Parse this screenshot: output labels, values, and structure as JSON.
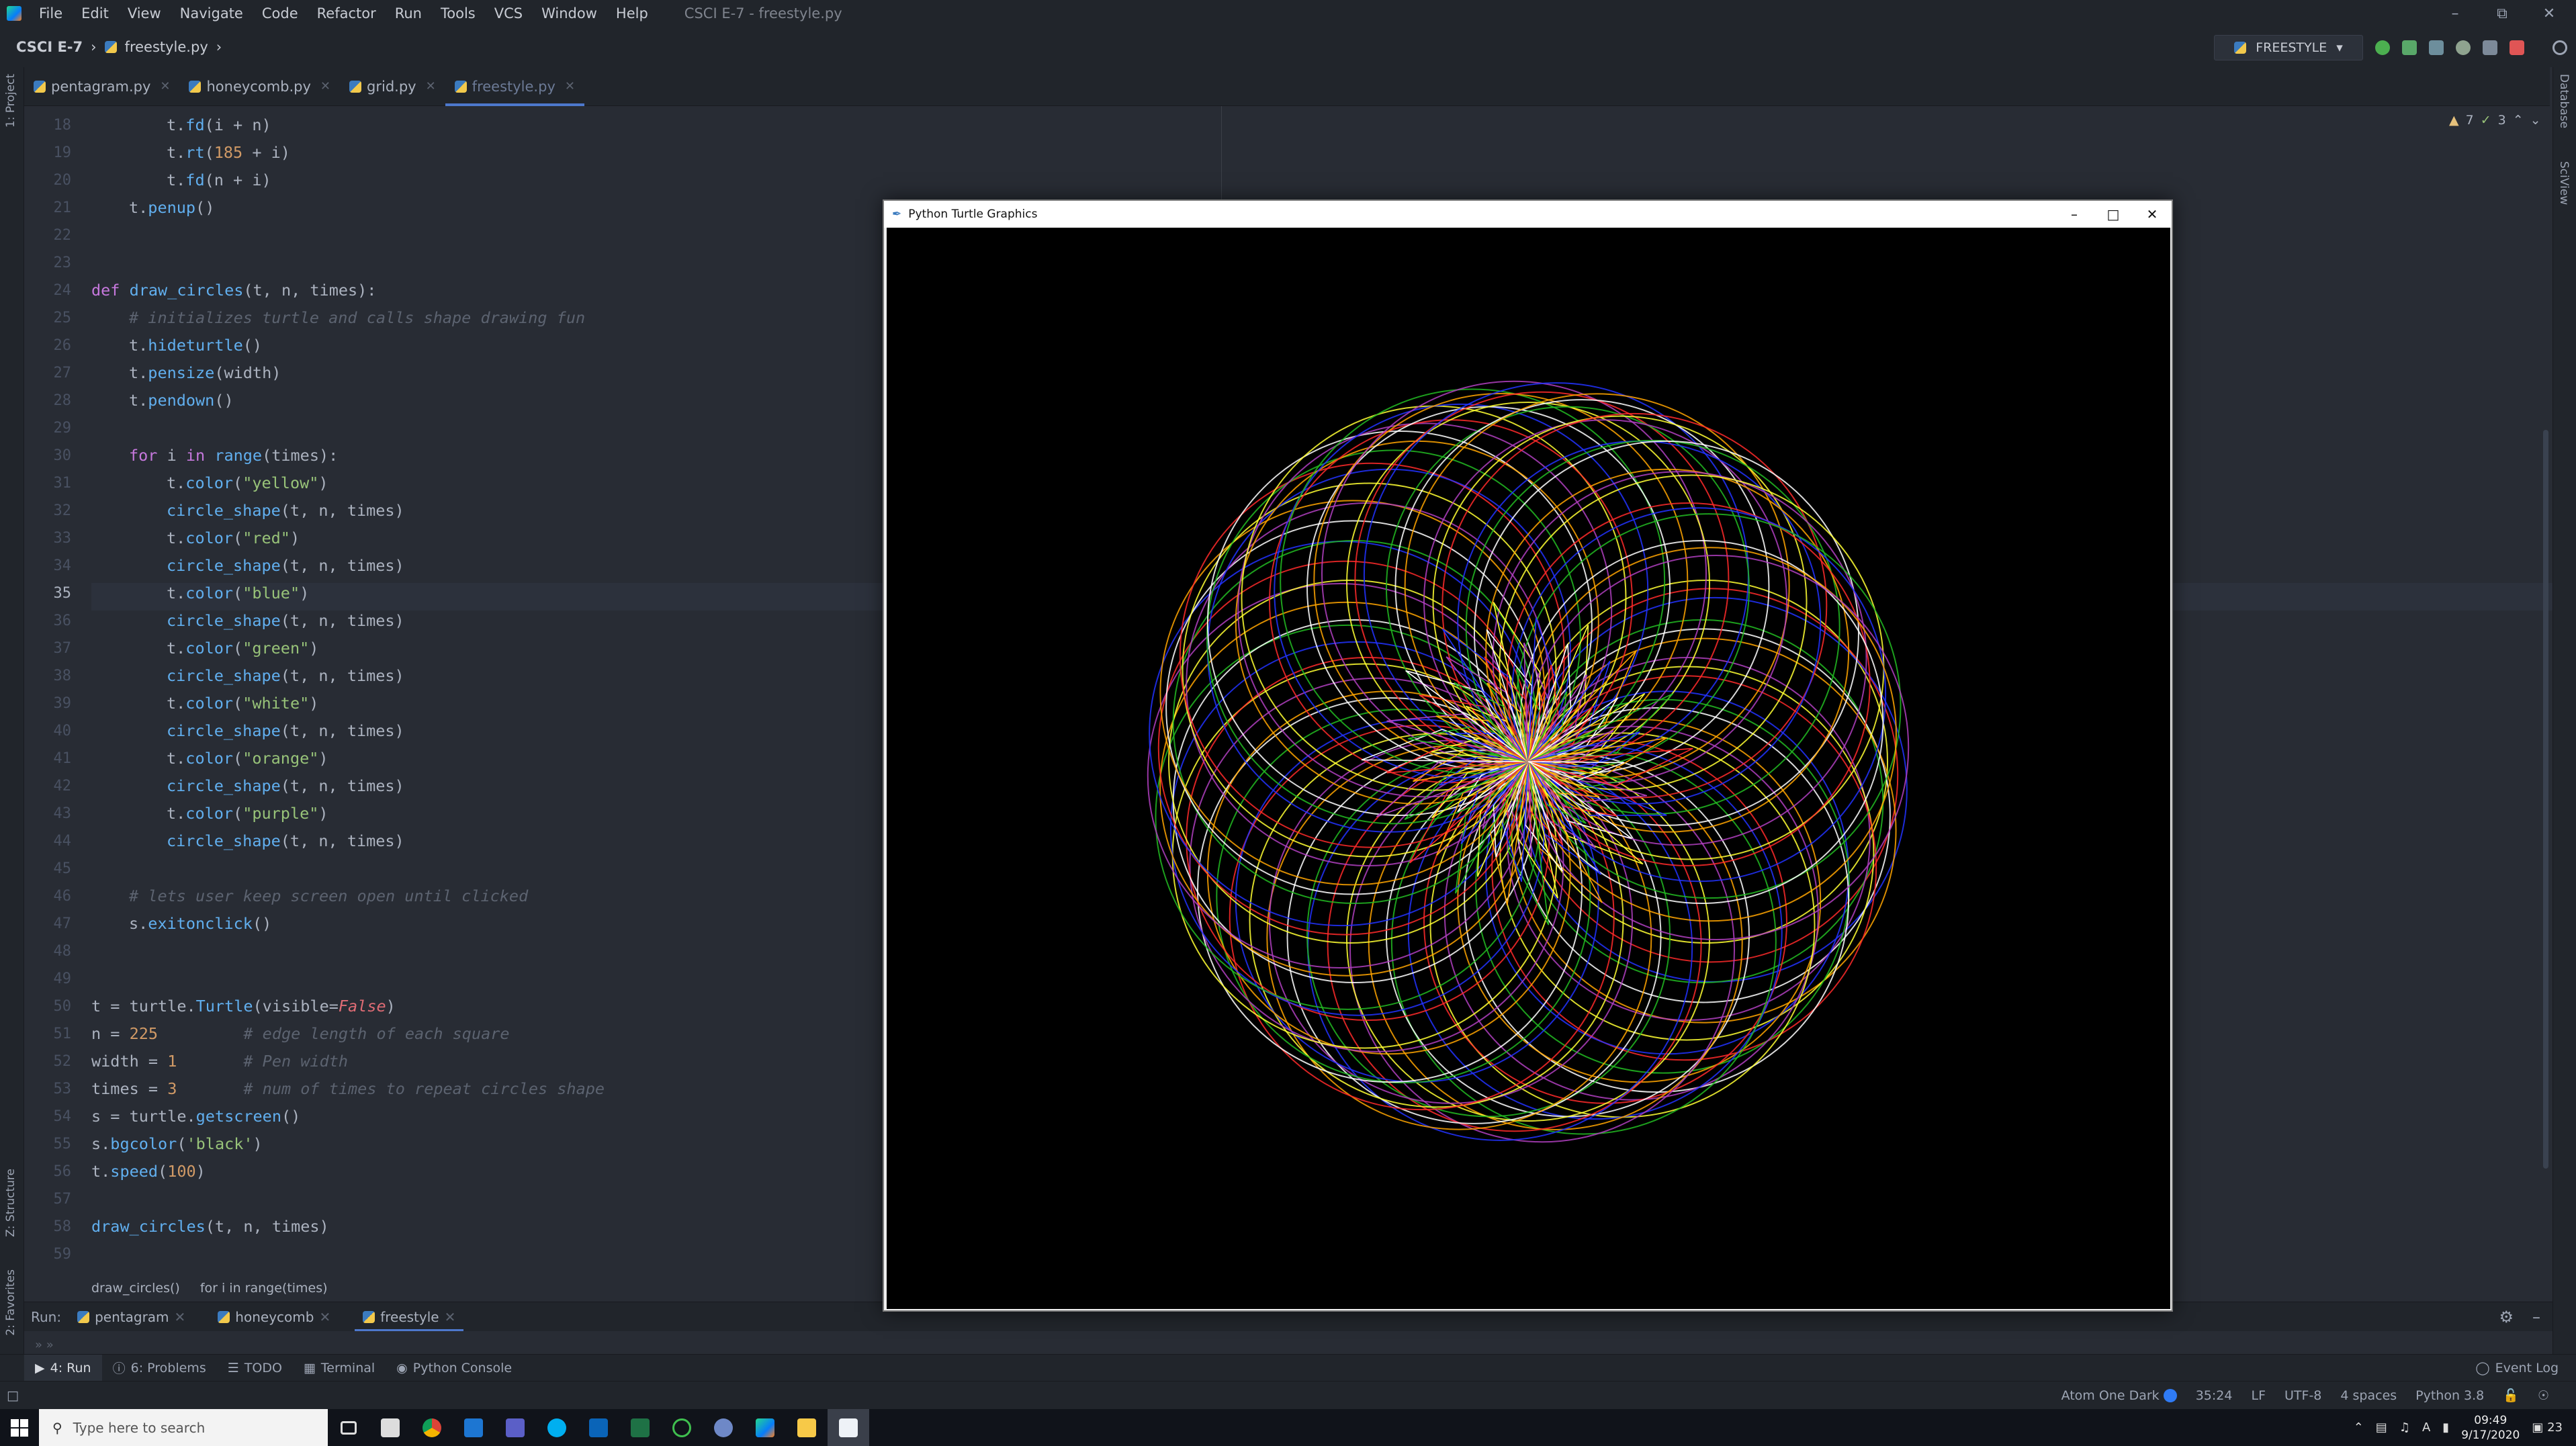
{
  "menubar": {
    "items": [
      "File",
      "Edit",
      "View",
      "Navigate",
      "Code",
      "Refactor",
      "Run",
      "Tools",
      "VCS",
      "Window",
      "Help"
    ],
    "window_title": "CSCI E-7 - freestyle.py"
  },
  "navbar": {
    "project": "CSCI E-7",
    "file": "freestyle.py",
    "run_config": "FREESTYLE"
  },
  "tabs": [
    {
      "label": "pentagram.py"
    },
    {
      "label": "honeycomb.py"
    },
    {
      "label": "grid.py"
    },
    {
      "label": "freestyle.py",
      "active": true
    }
  ],
  "left_strip": {
    "project": "1: Project",
    "structure": "Z: Structure",
    "favorites": "2: Favorites"
  },
  "right_strip": {
    "database": "Database",
    "sciview": "SciView"
  },
  "inspections": {
    "warnings": "7",
    "ok": "3"
  },
  "editor": {
    "current_line": 35,
    "lines": [
      {
        "n": 18,
        "indent": 2,
        "tokens": [
          [
            "",
            "t."
          ],
          [
            "fn",
            "fd"
          ],
          [
            "",
            "(i + n)"
          ]
        ]
      },
      {
        "n": 19,
        "indent": 2,
        "tokens": [
          [
            "",
            "t."
          ],
          [
            "fn",
            "rt"
          ],
          [
            "",
            "("
          ],
          [
            "num",
            "185"
          ],
          [
            "",
            " + i)"
          ]
        ]
      },
      {
        "n": 20,
        "indent": 2,
        "tokens": [
          [
            "",
            "t."
          ],
          [
            "fn",
            "fd"
          ],
          [
            "",
            "(n + i)"
          ]
        ]
      },
      {
        "n": 21,
        "indent": 1,
        "tokens": [
          [
            "",
            "t."
          ],
          [
            "fn",
            "penup"
          ],
          [
            "",
            "()"
          ]
        ]
      },
      {
        "n": 22,
        "indent": 0,
        "tokens": []
      },
      {
        "n": 23,
        "indent": 0,
        "tokens": []
      },
      {
        "n": 24,
        "indent": 0,
        "tokens": [
          [
            "kw",
            "def "
          ],
          [
            "fn",
            "draw_circles"
          ],
          [
            "",
            "(t, n, times):"
          ]
        ]
      },
      {
        "n": 25,
        "indent": 1,
        "tokens": [
          [
            "cmt",
            "# initializes turtle and calls shape drawing fun"
          ]
        ]
      },
      {
        "n": 26,
        "indent": 1,
        "tokens": [
          [
            "",
            "t."
          ],
          [
            "fn",
            "hideturtle"
          ],
          [
            "",
            "()"
          ]
        ]
      },
      {
        "n": 27,
        "indent": 1,
        "tokens": [
          [
            "",
            "t."
          ],
          [
            "fn",
            "pensize"
          ],
          [
            "",
            "(width)"
          ]
        ]
      },
      {
        "n": 28,
        "indent": 1,
        "tokens": [
          [
            "",
            "t."
          ],
          [
            "fn",
            "pendown"
          ],
          [
            "",
            "()"
          ]
        ]
      },
      {
        "n": 29,
        "indent": 0,
        "tokens": []
      },
      {
        "n": 30,
        "indent": 1,
        "tokens": [
          [
            "kw",
            "for "
          ],
          [
            "",
            "i "
          ],
          [
            "kw",
            "in "
          ],
          [
            "fn",
            "range"
          ],
          [
            "",
            "(times):"
          ]
        ]
      },
      {
        "n": 31,
        "indent": 2,
        "tokens": [
          [
            "",
            "t."
          ],
          [
            "fn",
            "color"
          ],
          [
            "",
            "("
          ],
          [
            "str",
            "\"yellow\""
          ],
          [
            "",
            ")"
          ]
        ]
      },
      {
        "n": 32,
        "indent": 2,
        "tokens": [
          [
            "fn",
            "circle_shape"
          ],
          [
            "",
            "(t, n, times)"
          ]
        ]
      },
      {
        "n": 33,
        "indent": 2,
        "tokens": [
          [
            "",
            "t."
          ],
          [
            "fn",
            "color"
          ],
          [
            "",
            "("
          ],
          [
            "str",
            "\"red\""
          ],
          [
            "",
            ")"
          ]
        ]
      },
      {
        "n": 34,
        "indent": 2,
        "tokens": [
          [
            "fn",
            "circle_shape"
          ],
          [
            "",
            "(t, n, times)"
          ]
        ]
      },
      {
        "n": 35,
        "indent": 2,
        "tokens": [
          [
            "",
            "t."
          ],
          [
            "fn",
            "color"
          ],
          [
            "",
            "("
          ],
          [
            "str",
            "\"blue\""
          ],
          [
            "",
            ")"
          ]
        ]
      },
      {
        "n": 36,
        "indent": 2,
        "tokens": [
          [
            "fn",
            "circle_shape"
          ],
          [
            "",
            "(t, n, times)"
          ]
        ]
      },
      {
        "n": 37,
        "indent": 2,
        "tokens": [
          [
            "",
            "t."
          ],
          [
            "fn",
            "color"
          ],
          [
            "",
            "("
          ],
          [
            "str",
            "\"green\""
          ],
          [
            "",
            ")"
          ]
        ]
      },
      {
        "n": 38,
        "indent": 2,
        "tokens": [
          [
            "fn",
            "circle_shape"
          ],
          [
            "",
            "(t, n, times)"
          ]
        ]
      },
      {
        "n": 39,
        "indent": 2,
        "tokens": [
          [
            "",
            "t."
          ],
          [
            "fn",
            "color"
          ],
          [
            "",
            "("
          ],
          [
            "str",
            "\"white\""
          ],
          [
            "",
            ")"
          ]
        ]
      },
      {
        "n": 40,
        "indent": 2,
        "tokens": [
          [
            "fn",
            "circle_shape"
          ],
          [
            "",
            "(t, n, times)"
          ]
        ]
      },
      {
        "n": 41,
        "indent": 2,
        "tokens": [
          [
            "",
            "t."
          ],
          [
            "fn",
            "color"
          ],
          [
            "",
            "("
          ],
          [
            "str",
            "\"orange\""
          ],
          [
            "",
            ")"
          ]
        ]
      },
      {
        "n": 42,
        "indent": 2,
        "tokens": [
          [
            "fn",
            "circle_shape"
          ],
          [
            "",
            "(t, n, times)"
          ]
        ]
      },
      {
        "n": 43,
        "indent": 2,
        "tokens": [
          [
            "",
            "t."
          ],
          [
            "fn",
            "color"
          ],
          [
            "",
            "("
          ],
          [
            "str",
            "\"purple\""
          ],
          [
            "",
            ")"
          ]
        ]
      },
      {
        "n": 44,
        "indent": 2,
        "tokens": [
          [
            "fn",
            "circle_shape"
          ],
          [
            "",
            "(t, n, times)"
          ]
        ]
      },
      {
        "n": 45,
        "indent": 0,
        "tokens": []
      },
      {
        "n": 46,
        "indent": 1,
        "tokens": [
          [
            "cmt",
            "# lets user keep screen open until clicked"
          ]
        ]
      },
      {
        "n": 47,
        "indent": 1,
        "tokens": [
          [
            "",
            "s."
          ],
          [
            "fn",
            "exitonclick"
          ],
          [
            "",
            "()"
          ]
        ]
      },
      {
        "n": 48,
        "indent": 0,
        "tokens": []
      },
      {
        "n": 49,
        "indent": 0,
        "tokens": []
      },
      {
        "n": 50,
        "indent": 0,
        "tokens": [
          [
            "",
            "t = turtle."
          ],
          [
            "fn",
            "Turtle"
          ],
          [
            "",
            "(visible="
          ],
          [
            "pm",
            "False"
          ],
          [
            "",
            ")"
          ]
        ]
      },
      {
        "n": 51,
        "indent": 0,
        "tokens": [
          [
            "",
            "n = "
          ],
          [
            "num",
            "225"
          ],
          [
            "",
            "         "
          ],
          [
            "cmt",
            "# edge length of each square"
          ]
        ]
      },
      {
        "n": 52,
        "indent": 0,
        "tokens": [
          [
            "",
            "width = "
          ],
          [
            "num",
            "1"
          ],
          [
            "",
            "       "
          ],
          [
            "cmt",
            "# Pen width"
          ]
        ]
      },
      {
        "n": 53,
        "indent": 0,
        "tokens": [
          [
            "",
            "times = "
          ],
          [
            "num",
            "3"
          ],
          [
            "",
            "       "
          ],
          [
            "cmt",
            "# num of times to repeat circles shape"
          ]
        ]
      },
      {
        "n": 54,
        "indent": 0,
        "tokens": [
          [
            "",
            "s = turtle."
          ],
          [
            "fn",
            "getscreen"
          ],
          [
            "",
            "()"
          ]
        ]
      },
      {
        "n": 55,
        "indent": 0,
        "tokens": [
          [
            "",
            "s."
          ],
          [
            "fn",
            "bgcolor"
          ],
          [
            "",
            "("
          ],
          [
            "str",
            "'black'"
          ],
          [
            "",
            ")"
          ]
        ]
      },
      {
        "n": 56,
        "indent": 0,
        "tokens": [
          [
            "",
            "t."
          ],
          [
            "fn",
            "speed"
          ],
          [
            "",
            "("
          ],
          [
            "num",
            "100"
          ],
          [
            "",
            ")"
          ]
        ]
      },
      {
        "n": 57,
        "indent": 0,
        "tokens": []
      },
      {
        "n": 58,
        "indent": 0,
        "tokens": [
          [
            "fn",
            "draw_circles"
          ],
          [
            "",
            "(t, n, times)"
          ]
        ]
      },
      {
        "n": 59,
        "indent": 0,
        "tokens": []
      }
    ]
  },
  "code_breadcrumbs": [
    "draw_circles()",
    "for i in range(times)"
  ],
  "run_panel": {
    "label": "Run:",
    "tabs": [
      {
        "label": "pentagram"
      },
      {
        "label": "honeycomb"
      },
      {
        "label": "freestyle",
        "active": true
      }
    ]
  },
  "tool_windows": [
    {
      "label": "4: Run",
      "icon": "play-icon",
      "active": true
    },
    {
      "label": "6: Problems",
      "icon": "info-icon"
    },
    {
      "label": "TODO",
      "icon": "list-icon"
    },
    {
      "label": "Terminal",
      "icon": "terminal-icon"
    },
    {
      "label": "Python Console",
      "icon": "python-icon"
    }
  ],
  "event_log": "Event Log",
  "statusbar": {
    "theme": "Atom One Dark",
    "position": "35:24",
    "line_sep": "LF",
    "encoding": "UTF-8",
    "indent": "4 spaces",
    "interpreter": "Python 3.8"
  },
  "turtle_window": {
    "title": "Python Turtle Graphics",
    "canvas_bg": "#000000",
    "pen_colors": [
      "yellow",
      "red",
      "blue",
      "green",
      "white",
      "orange",
      "purple"
    ]
  },
  "taskbar": {
    "search_placeholder": "Type here to search",
    "time": "09:49",
    "date": "9/17/2020",
    "notifications": "23"
  }
}
